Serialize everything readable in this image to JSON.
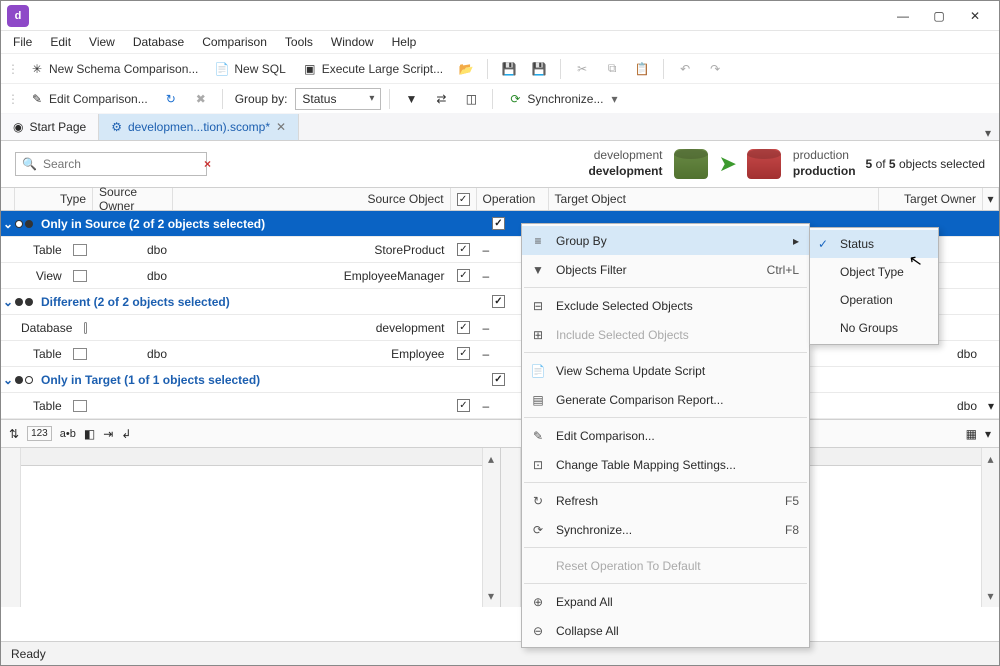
{
  "menu": {
    "file": "File",
    "edit": "Edit",
    "view": "View",
    "database": "Database",
    "comparison": "Comparison",
    "tools": "Tools",
    "window": "Window",
    "help": "Help"
  },
  "toolbar1": {
    "new_schema": "New Schema Comparison...",
    "new_sql": "New SQL",
    "exec_large": "Execute Large Script..."
  },
  "toolbar2": {
    "edit_comp": "Edit Comparison...",
    "group_by_label": "Group by:",
    "group_by_value": "Status",
    "sync": "Synchronize..."
  },
  "tabs": {
    "start": "Start Page",
    "active": "developmen...tion).scomp*"
  },
  "search_placeholder": "Search",
  "db": {
    "src_small": "development",
    "src_big": "development",
    "tgt_small": "production",
    "tgt_big": "production"
  },
  "selected": {
    "n": "5",
    "of": " of ",
    "m": "5",
    "tail": " objects selected"
  },
  "cols": {
    "type": "Type",
    "sowner": "Source Owner",
    "sobj": "Source Object",
    "op": "Operation",
    "tobj": "Target Object",
    "towner": "Target Owner"
  },
  "groups": {
    "src": "Only in Source (2 of 2 objects selected)",
    "diff": "Different (2 of 2 objects selected)",
    "tgt": "Only in Target (1 of 1 objects selected)"
  },
  "rows": {
    "r1_type": "Table",
    "r1_owner": "dbo",
    "r1_obj": "StoreProduct",
    "r2_type": "View",
    "r2_owner": "dbo",
    "r2_obj": "EmployeeManager",
    "r3_type": "Database",
    "r3_obj": "development",
    "r4_type": "Table",
    "r4_owner": "dbo",
    "r4_obj": "Employee",
    "r4_towner": "dbo",
    "r5_type": "Table",
    "r5_towner": "dbo"
  },
  "ctx": {
    "group_by": "Group By",
    "objects_filter": "Objects Filter",
    "objects_filter_sc": "Ctrl+L",
    "exclude": "Exclude Selected Objects",
    "include": "Include Selected Objects",
    "view_script": "View Schema Update Script",
    "gen_report": "Generate Comparison Report...",
    "edit_comp": "Edit Comparison...",
    "mapping": "Change Table Mapping Settings...",
    "refresh": "Refresh",
    "refresh_sc": "F5",
    "sync": "Synchronize...",
    "sync_sc": "F8",
    "reset": "Reset Operation To Default",
    "expand": "Expand All",
    "collapse": "Collapse All"
  },
  "sub": {
    "status": "Status",
    "objtype": "Object Type",
    "operation": "Operation",
    "nogroups": "No Groups"
  },
  "status": "Ready"
}
